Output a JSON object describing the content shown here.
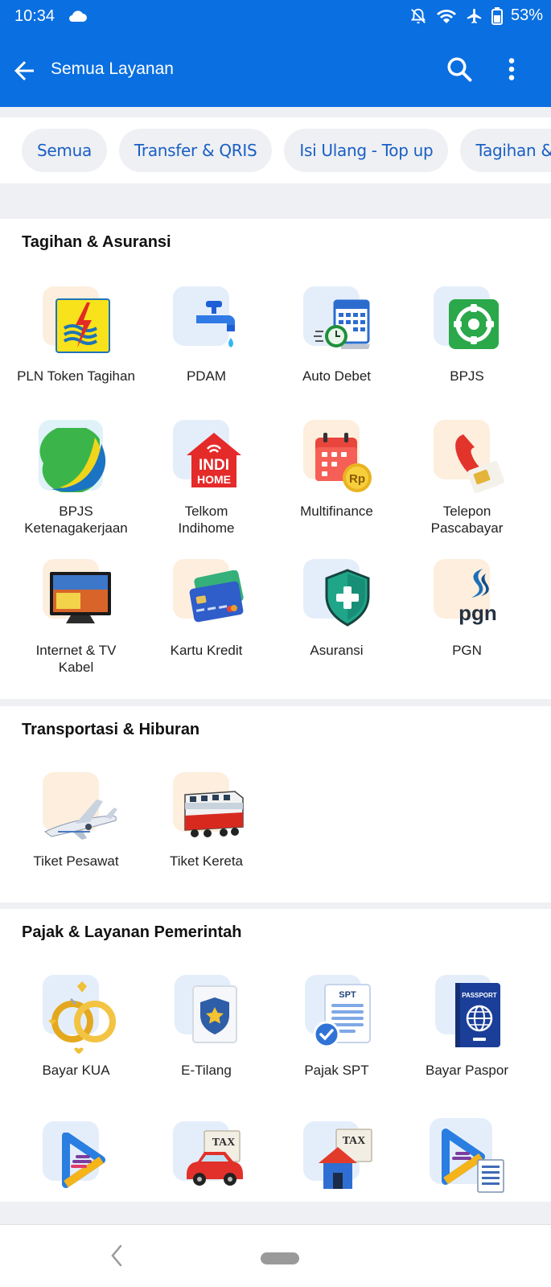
{
  "status_bar": {
    "time": "10:34",
    "battery": "53%"
  },
  "app_bar": {
    "title": "Semua Layanan"
  },
  "chips": [
    "Semua",
    "Transfer & QRIS",
    "Isi Ulang - Top up",
    "Tagihan & Asuransi"
  ],
  "sections": {
    "tagihan": {
      "title": "Tagihan & Asuransi",
      "items": {
        "pln": "PLN Token Tagihan",
        "pdam": "PDAM",
        "autodebet": "Auto Debet",
        "bpjs": "BPJS",
        "bpjstk": "BPJS\nKetenagakerjaan",
        "telkom": "Telkom\nIndihome",
        "multifinance": "Multifinance",
        "telepon": "Telepon\nPascabayar",
        "internet": "Internet & TV\nKabel",
        "kartu": "Kartu Kredit",
        "asuransi": "Asuransi",
        "pgn": "PGN"
      }
    },
    "transport": {
      "title": "Transportasi & Hiburan",
      "items": {
        "pesawat": "Tiket Pesawat",
        "kereta": "Tiket Kereta"
      }
    },
    "pajak": {
      "title": "Pajak & Layanan Pemerintah",
      "items": {
        "kua": "Bayar KUA",
        "etilang": "E-Tilang",
        "spt": "Pajak SPT",
        "paspor": "Bayar Paspor"
      }
    }
  },
  "icon_text": {
    "indihome_1": "INDI",
    "indihome_2": "HOME",
    "rp": "Rp",
    "pgn": "pgn",
    "spt": "SPT",
    "tax": "TAX",
    "passport": "PASSPORT"
  },
  "colors": {
    "primary": "#0a6fe0",
    "chip_text": "#1a5fc4",
    "peach": "#fdeedd",
    "light_blue": "#e4eefb"
  }
}
